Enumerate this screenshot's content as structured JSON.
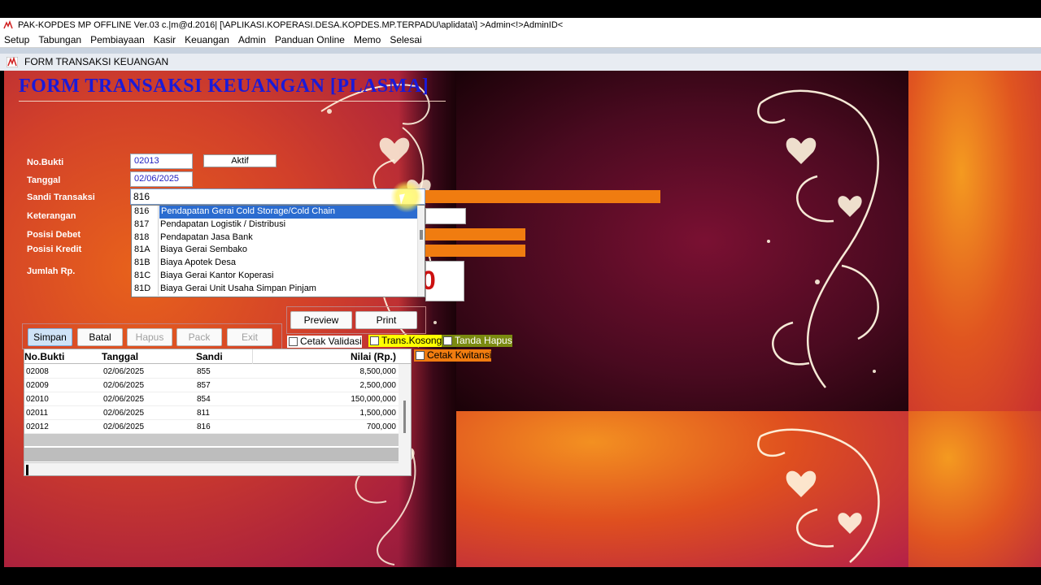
{
  "window": {
    "title": "PAK-KOPDES MP OFFLINE Ver.03 c.|m@d.2016| [\\APLIKASI.KOPERASI.DESA.KOPDES.MP.TERPADU\\aplidata\\] >Admin<!>AdminID<"
  },
  "menu": {
    "items": [
      "Setup",
      "Tabungan",
      "Pembiayaan",
      "Kasir",
      "Keuangan",
      "Admin",
      "Panduan Online",
      "Memo",
      "Selesai"
    ]
  },
  "form": {
    "window_title": "FORM TRANSAKSI KEUANGAN",
    "heading": "FORM TRANSAKSI KEUANGAN [PLASMA]",
    "labels": {
      "no_bukti": "No.Bukti",
      "tanggal": "Tanggal",
      "sandi_transaksi": "Sandi Transaksi",
      "keterangan": "Keterangan",
      "posisi_debet": "Posisi Debet",
      "posisi_kredit": "Posisi Kredit",
      "jumlah_rp": "Jumlah Rp."
    },
    "values": {
      "no_bukti": "02013",
      "status": "Aktif",
      "tanggal": "02/06/2025",
      "sandi_transaksi": "816",
      "jumlah_partial": "0"
    }
  },
  "dropdown": {
    "selected_code": "816",
    "options": [
      {
        "code": "816",
        "desc": "Pendapatan Gerai Cold Storage/Cold Chain"
      },
      {
        "code": "817",
        "desc": "Pendapatan Logistik / Distribusi"
      },
      {
        "code": "818",
        "desc": "Pendapatan Jasa Bank"
      },
      {
        "code": "81A",
        "desc": "Biaya Gerai Sembako"
      },
      {
        "code": "81B",
        "desc": "Biaya Apotek Desa"
      },
      {
        "code": "81C",
        "desc": "Biaya Gerai Kantor Koperasi"
      },
      {
        "code": "81D",
        "desc": "Biaya Gerai Unit Usaha Simpan Pinjam"
      }
    ]
  },
  "buttons": {
    "simpan": "Simpan",
    "batal": "Batal",
    "hapus": "Hapus",
    "pack": "Pack",
    "exit": "Exit",
    "preview": "Preview",
    "print": "Print"
  },
  "checkboxes": {
    "cetak_validasi": "Cetak Validasi",
    "trans_kosong": "Trans.Kosong",
    "tanda_hapus": "Tanda Hapus",
    "cetak_kwitansi": "Cetak Kwitansi"
  },
  "grid": {
    "headers": {
      "no_bukti": "No.Bukti",
      "tanggal": "Tanggal",
      "sandi": "Sandi",
      "nilai": "Nilai (Rp.)"
    },
    "rows": [
      {
        "no_bukti": "02008",
        "tanggal": "02/06/2025",
        "sandi": "855",
        "nilai": "8,500,000"
      },
      {
        "no_bukti": "02009",
        "tanggal": "02/06/2025",
        "sandi": "857",
        "nilai": "2,500,000"
      },
      {
        "no_bukti": "02010",
        "tanggal": "02/06/2025",
        "sandi": "854",
        "nilai": "150,000,000"
      },
      {
        "no_bukti": "02011",
        "tanggal": "02/06/2025",
        "sandi": "811",
        "nilai": "1,500,000"
      },
      {
        "no_bukti": "02012",
        "tanggal": "02/06/2025",
        "sandi": "816",
        "nilai": "700,000"
      }
    ]
  },
  "colors": {
    "heading": "#1a1ad8",
    "selection": "#2b6cd0",
    "accent_orange": "#f07c10",
    "amount_red": "#cc1010"
  },
  "icons": {
    "app": "app-logo-icon",
    "form": "form-logo-icon",
    "dropdown": "chevron-down-icon"
  }
}
